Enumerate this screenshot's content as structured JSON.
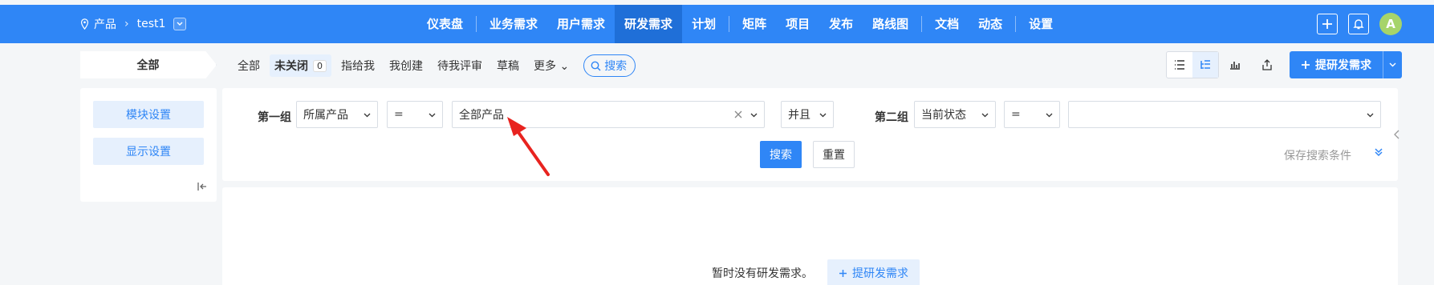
{
  "topbar": {
    "crumb_product": "产品",
    "crumb_project": "test1",
    "nav": [
      "仪表盘",
      "业务需求",
      "用户需求",
      "研发需求",
      "计划",
      "矩阵",
      "项目",
      "发布",
      "路线图",
      "文档",
      "动态",
      "设置"
    ],
    "active_nav": "研发需求",
    "avatar_letter": "A",
    "accent": "#2f86f6"
  },
  "subnav": {
    "all_label": "全部",
    "filters": [
      "全部",
      "未关闭",
      "指给我",
      "我创建",
      "待我评审",
      "草稿",
      "更多"
    ],
    "active_filter": "未关闭",
    "active_count": "0",
    "search_label": "搜索",
    "create_button": "提研发需求"
  },
  "side": {
    "module_settings": "模块设置",
    "display_settings": "显示设置"
  },
  "search": {
    "group1_label": "第一组",
    "group1_field": "所属产品",
    "group1_op": "=",
    "group1_value": "全部产品",
    "logic": "并且",
    "group2_label": "第二组",
    "group2_field": "当前状态",
    "group2_op": "=",
    "group2_value": "",
    "search_button": "搜索",
    "reset_button": "重置",
    "save_conditions": "保存搜索条件"
  },
  "empty_state": {
    "message": "暂时没有研发需求。",
    "add_button": "提研发需求"
  }
}
